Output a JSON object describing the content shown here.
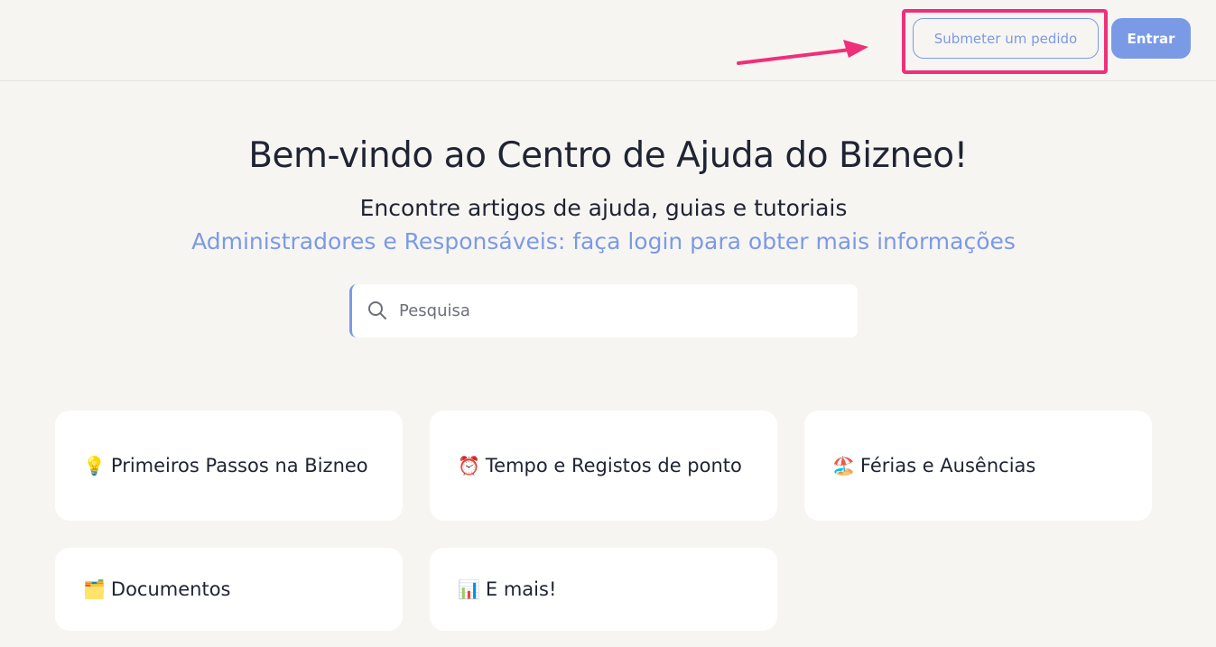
{
  "header": {
    "submit_label": "Submeter um pedido",
    "login_label": "Entrar"
  },
  "hero": {
    "title": "Bem-vindo ao Centro de Ajuda do Bizneo!",
    "subtitle": "Encontre artigos de ajuda, guias e tutoriais",
    "admin_note": "Administradores e Responsáveis: faça login para obter mais informações"
  },
  "search": {
    "placeholder": "Pesquisa"
  },
  "categories": [
    {
      "icon": "💡",
      "icon_name": "lightbulb-icon",
      "label": "Primeiros Passos na Bizneo"
    },
    {
      "icon": "⏰",
      "icon_name": "alarm-clock-icon",
      "label": "Tempo e Registos de ponto"
    },
    {
      "icon": "🏖️",
      "icon_name": "beach-umbrella-icon",
      "label": "Férias e Ausências"
    },
    {
      "icon": "🗂️",
      "icon_name": "folder-icon",
      "label": "Documentos"
    },
    {
      "icon": "📊",
      "icon_name": "bar-chart-icon",
      "label": "E mais!"
    }
  ],
  "colors": {
    "accent": "#7b9ae6",
    "highlight": "#ef2f7a",
    "background": "#f7f5f2",
    "text": "#1f2433"
  }
}
